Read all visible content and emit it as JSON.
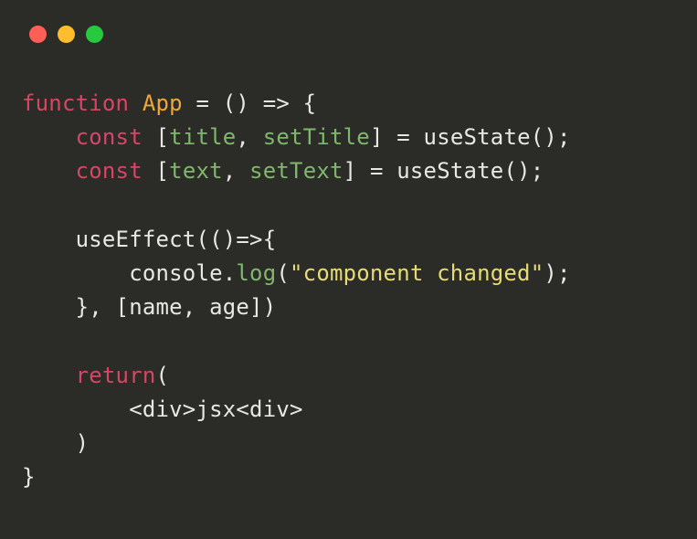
{
  "window": {
    "traffic_lights": [
      "close",
      "minimize",
      "zoom"
    ]
  },
  "code": {
    "line1": {
      "kw_function": "function",
      "fn_name": "App",
      "rest": " = () => {"
    },
    "line2": {
      "indent": "    ",
      "kw_const": "const",
      "bracket_open": " [",
      "id_title": "title",
      "comma": ", ",
      "id_setTitle": "setTitle",
      "bracket_close": "] = ",
      "call": "useState();"
    },
    "line3": {
      "indent": "    ",
      "kw_const": "const",
      "bracket_open": " [",
      "id_text": "text",
      "comma": ", ",
      "id_setText": "setText",
      "bracket_close": "] = ",
      "call": "useState();"
    },
    "line5": {
      "indent": "    ",
      "text": "useEffect(()=>{"
    },
    "line6": {
      "indent": "        ",
      "obj": "console",
      "dot": ".",
      "method": "log",
      "paren": "(",
      "str": "\"component changed\"",
      "close": ");"
    },
    "line7": {
      "indent": "    ",
      "text": "}, [name, age])"
    },
    "line9": {
      "indent": "    ",
      "kw_return": "return",
      "paren": "("
    },
    "line10": {
      "indent": "        ",
      "text": "<div>jsx<div>"
    },
    "line11": {
      "indent": "    ",
      "text": ")"
    },
    "line12": {
      "text": "}"
    }
  }
}
